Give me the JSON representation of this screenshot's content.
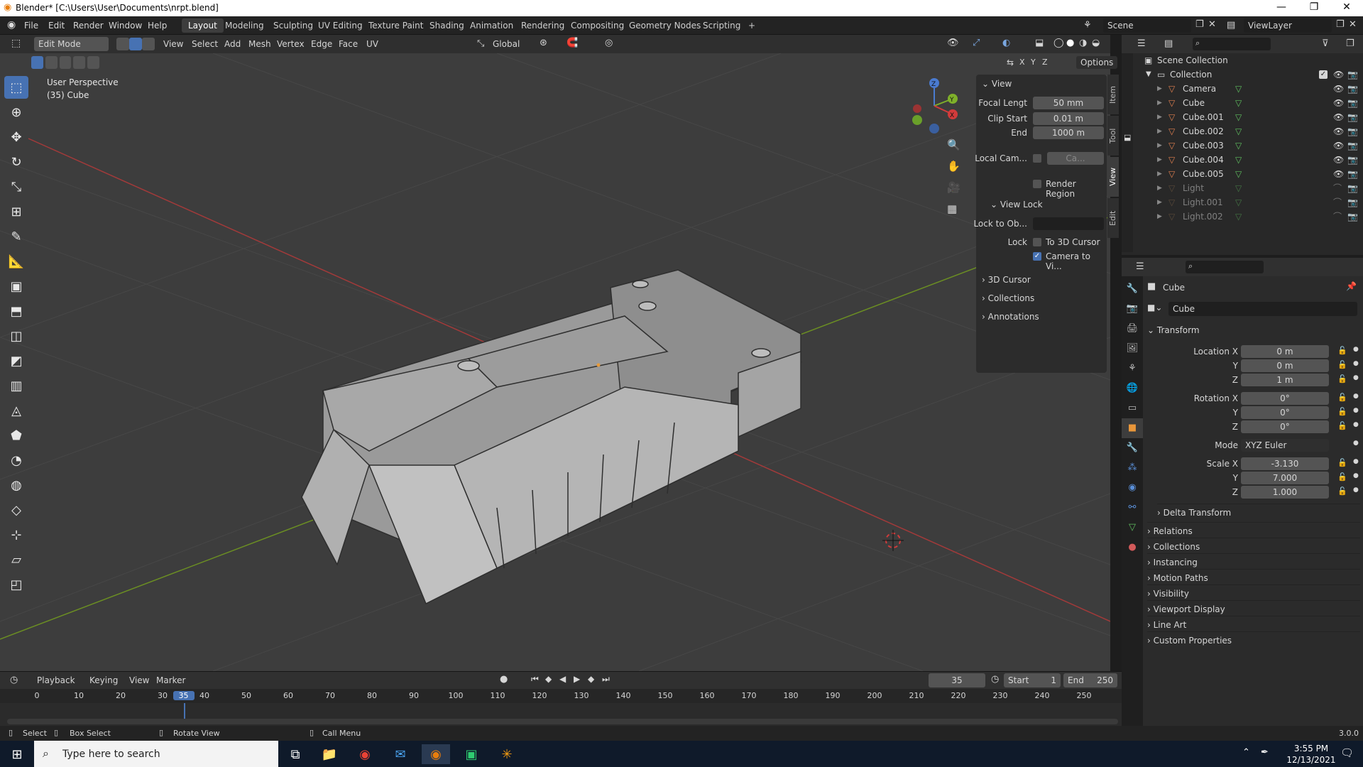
{
  "titlebar": {
    "title": "Blender* [C:\\Users\\User\\Documents\\nrpt.blend]",
    "minimize": "—",
    "maximize": "❐",
    "close": "✕"
  },
  "menus": [
    "File",
    "Edit",
    "Render",
    "Window",
    "Help"
  ],
  "workspaces": [
    "Layout",
    "Modeling",
    "Sculpting",
    "UV Editing",
    "Texture Paint",
    "Shading",
    "Animation",
    "Rendering",
    "Compositing",
    "Geometry Nodes",
    "Scripting",
    "+"
  ],
  "active_workspace": "Layout",
  "scene": {
    "name": "Scene",
    "viewlayer": "ViewLayer"
  },
  "viewport_header": {
    "mode": "Edit Mode",
    "menus": [
      "View",
      "Select",
      "Add",
      "Mesh",
      "Vertex",
      "Edge",
      "Face",
      "UV"
    ],
    "orientation": "Global",
    "options": "Options",
    "axes": [
      "X",
      "Y",
      "Z"
    ]
  },
  "viewport": {
    "perspective": "User Perspective",
    "object": "(35) Cube"
  },
  "gizmo": {
    "x": "X",
    "y": "Y",
    "z": "Z"
  },
  "npanel": {
    "tabs": [
      "Item",
      "Tool",
      "View",
      "Edit"
    ],
    "view_section": "View",
    "focal_label": "Focal Lengt",
    "focal_value": "50 mm",
    "clip_start_label": "Clip Start",
    "clip_start_value": "0.01 m",
    "end_label": "End",
    "end_value": "1000 m",
    "local_cam_label": "Local Cam...",
    "local_cam_value": "Ca...",
    "render_region": "Render Region",
    "view_lock": "View Lock",
    "lock_to_obj": "Lock to Ob...",
    "lock_label": "Lock",
    "to_3d_cursor": "To 3D Cursor",
    "camera_to_view": "Camera to Vi...",
    "collapsed": [
      "3D Cursor",
      "Collections",
      "Annotations"
    ]
  },
  "outliner": {
    "root": "Scene Collection",
    "collection": "Collection",
    "items": [
      {
        "name": "Camera",
        "color": "#e07f4f",
        "dim": false
      },
      {
        "name": "Cube",
        "color": "#e07f4f",
        "dim": false
      },
      {
        "name": "Cube.001",
        "color": "#e07f4f",
        "dim": false
      },
      {
        "name": "Cube.002",
        "color": "#e07f4f",
        "dim": false
      },
      {
        "name": "Cube.003",
        "color": "#e07f4f",
        "dim": false
      },
      {
        "name": "Cube.004",
        "color": "#e07f4f",
        "dim": false
      },
      {
        "name": "Cube.005",
        "color": "#e07f4f",
        "dim": false
      },
      {
        "name": "Light",
        "color": "#8a6a4a",
        "dim": true
      },
      {
        "name": "Light.001",
        "color": "#8a6a4a",
        "dim": true
      },
      {
        "name": "Light.002",
        "color": "#8a6a4a",
        "dim": true
      }
    ]
  },
  "properties": {
    "object_name": "Cube",
    "data_name": "Cube",
    "transform": "Transform",
    "location_x_label": "Location X",
    "location_x": "0 m",
    "location_y": "0 m",
    "location_z": "1 m",
    "rotation_x_label": "Rotation X",
    "rotation_x": "0°",
    "rotation_y": "0°",
    "rotation_z": "0°",
    "mode_label": "Mode",
    "mode_value": "XYZ Euler",
    "scale_x_label": "Scale X",
    "scale_x": "-3.130",
    "scale_y": "7.000",
    "scale_z": "1.000",
    "y_label": "Y",
    "z_label": "Z",
    "delta_transform": "Delta Transform",
    "sections": [
      "Relations",
      "Collections",
      "Instancing",
      "Motion Paths",
      "Visibility",
      "Viewport Display",
      "Line Art",
      "Custom Properties"
    ]
  },
  "timeline": {
    "menus": [
      "Playback",
      "Keying",
      "View",
      "Marker"
    ],
    "current_frame": "35",
    "start_label": "Start",
    "start": "1",
    "end_label": "End",
    "end": "250",
    "ticks": [
      "0",
      "10",
      "20",
      "30",
      "35",
      "40",
      "50",
      "60",
      "70",
      "80",
      "90",
      "100",
      "110",
      "120",
      "130",
      "140",
      "150",
      "160",
      "170",
      "180",
      "190",
      "200",
      "210",
      "220",
      "230",
      "240",
      "250"
    ]
  },
  "statusbar": {
    "select": "Select",
    "box_select": "Box Select",
    "rotate_view": "Rotate View",
    "call_menu": "Call Menu",
    "version": "3.0.0"
  },
  "taskbar": {
    "search_placeholder": "Type here to search",
    "time": "3:55 PM",
    "date": "12/13/2021"
  }
}
